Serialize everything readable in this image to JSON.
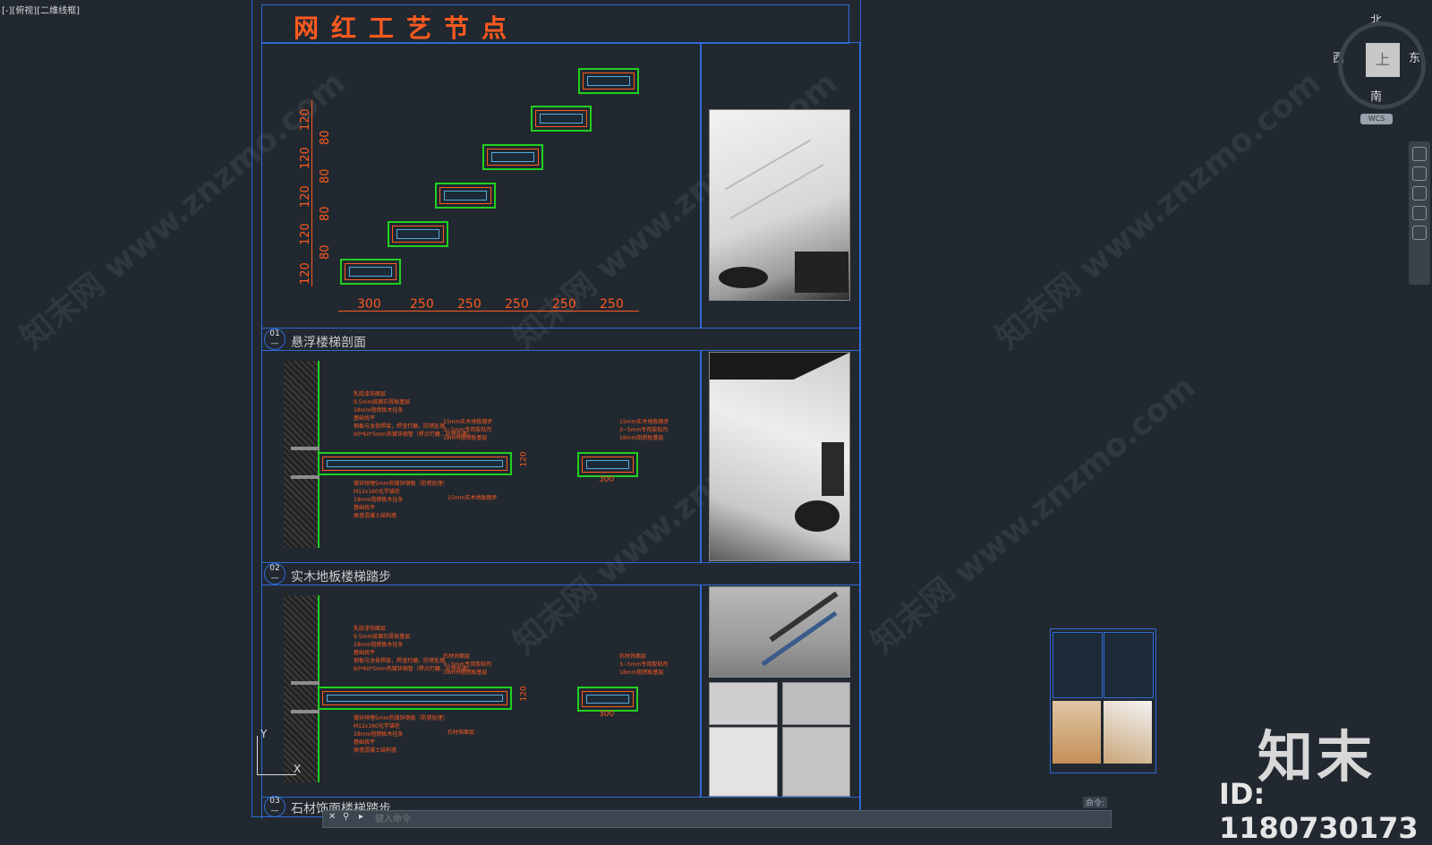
{
  "viewport_label": "[-][俯视][二维线框]",
  "sheet": {
    "title": "网红工艺节点",
    "sections": [
      {
        "num": "01",
        "label": "悬浮楼梯剖面"
      },
      {
        "num": "02",
        "label": "实木地板楼梯踏步"
      },
      {
        "num": "03",
        "label": "石材饰面楼梯踏步"
      }
    ],
    "horizontal_dims": [
      "300",
      "250",
      "250",
      "250",
      "250",
      "250"
    ],
    "vertical_dims": [
      "120",
      "80",
      "120",
      "80",
      "120",
      "80",
      "120",
      "80",
      "120"
    ],
    "detail_dims": {
      "thickness": "120",
      "width": "300"
    },
    "notes_02_left": [
      "乳胶漆饰面层",
      "9.5mm纸面石膏板基层",
      "18mm阻燃板木挂条",
      "基础找平",
      "钢板与龙骨焊接，焊渣打磨，防锈处理",
      "60*60*5mm热镀锌钢管（焊点打磨，防锈处理）",
      "镀锌预埋5mm热镀锌钢板（防锈处理）",
      "M12x160化学锚栓",
      "18mm阻燃板木挂条",
      "基础找平",
      "原墙混凝土结构墙"
    ],
    "notes_02_mid": [
      "15mm实木地板踏步",
      "3~5mm专用胶粘剂",
      "18mm阻燃板基层",
      "15mm实木地板踏步"
    ],
    "notes_03_left": [
      "乳胶漆饰面层",
      "9.5mm纸面石膏板基层",
      "18mm阻燃板木挂条",
      "基础找平",
      "钢板与龙骨焊接，焊渣打磨，防锈处理",
      "60*60*5mm热镀锌钢管（焊点打磨，防锈处理）",
      "镀锌预埋5mm热镀锌钢板（防锈处理）",
      "M12x160化学锚栓",
      "18mm阻燃板木挂条",
      "基础找平",
      "原墙混凝土结构墙"
    ],
    "notes_03_mid": [
      "石材饰面层",
      "3~5mm专用胶粘剂",
      "18mm阻燃板基层",
      "石材饰面层"
    ]
  },
  "compass": {
    "north": "北",
    "south": "南",
    "east": "东",
    "west": "西",
    "top": "上",
    "wcs": "WCS"
  },
  "ucs": {
    "y": "Y",
    "x": "X"
  },
  "command_line": {
    "tag": "命令:",
    "placeholder": "键入命令"
  },
  "watermark": {
    "text": "知末网 www.znzmo.com",
    "brand": "知末",
    "id": "ID: 1180730173"
  },
  "colors": {
    "accent": "#ff5a1f",
    "frame": "#2f6bd6",
    "green": "#20d020",
    "bg": "#212830"
  }
}
